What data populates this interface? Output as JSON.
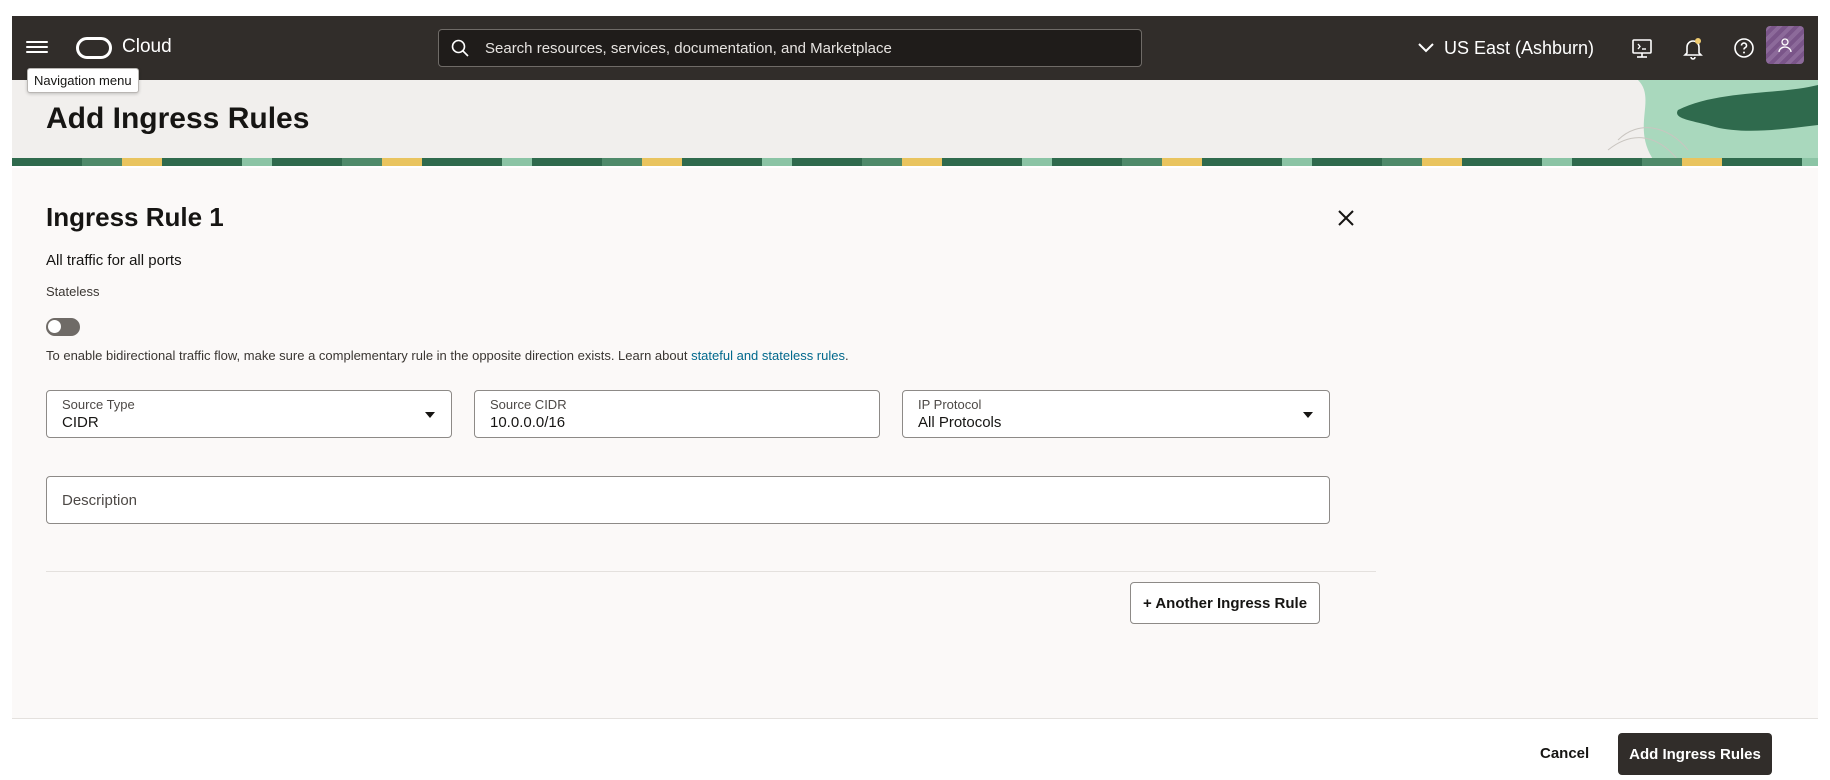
{
  "topbar": {
    "brand": "Cloud",
    "search_placeholder": "Search resources, services, documentation, and Marketplace",
    "region": "US East (Ashburn)",
    "tooltip": "Navigation menu",
    "icons": [
      "menu-icon",
      "cloud-shell-icon",
      "notifications-icon",
      "help-icon",
      "profile-icon"
    ]
  },
  "page": {
    "title": "Add Ingress Rules"
  },
  "rule": {
    "title": "Ingress Rule 1",
    "subtitle": "All traffic for all ports",
    "stateless_label": "Stateless",
    "stateless_enabled": false,
    "help_prefix": "To enable bidirectional traffic flow, make sure a complementary rule in the opposite direction exists. Learn about ",
    "help_link": "stateful and stateless rules",
    "help_suffix": ".",
    "source_type": {
      "label": "Source Type",
      "value": "CIDR"
    },
    "source_cidr": {
      "label": "Source CIDR",
      "value": "10.0.0.0/16"
    },
    "ip_protocol": {
      "label": "IP Protocol",
      "value": "All Protocols"
    },
    "description": {
      "placeholder": "Description"
    }
  },
  "actions": {
    "another_rule": "+ Another Ingress Rule",
    "cancel": "Cancel",
    "submit": "Add Ingress Rules"
  },
  "colors": {
    "topbar": "#312d2a",
    "link": "#00688c",
    "primary_button": "#312d2a"
  }
}
